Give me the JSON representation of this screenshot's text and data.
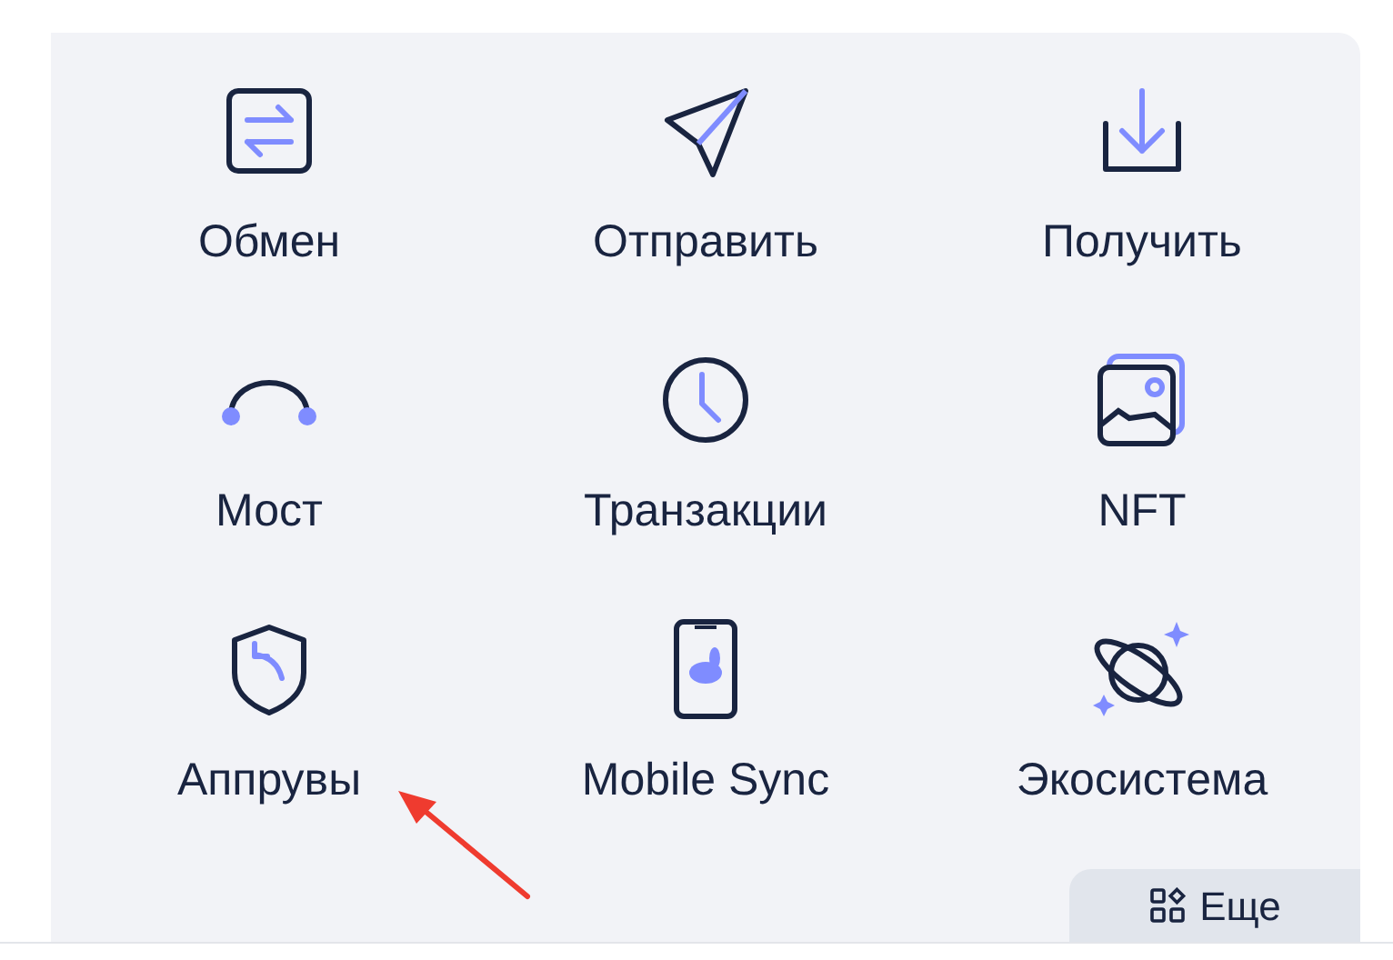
{
  "actions": [
    {
      "kind": "swap",
      "label": "Обмен"
    },
    {
      "kind": "send",
      "label": "Отправить"
    },
    {
      "kind": "receive",
      "label": "Получить"
    },
    {
      "kind": "bridge",
      "label": "Мост"
    },
    {
      "kind": "history",
      "label": "Транзакции"
    },
    {
      "kind": "nft",
      "label": "NFT"
    },
    {
      "kind": "approvals",
      "label": "Аппрувы"
    },
    {
      "kind": "mobile",
      "label": "Mobile Sync"
    },
    {
      "kind": "ecosystem",
      "label": "Экосистема"
    }
  ],
  "more_button": {
    "label": "Еще"
  }
}
